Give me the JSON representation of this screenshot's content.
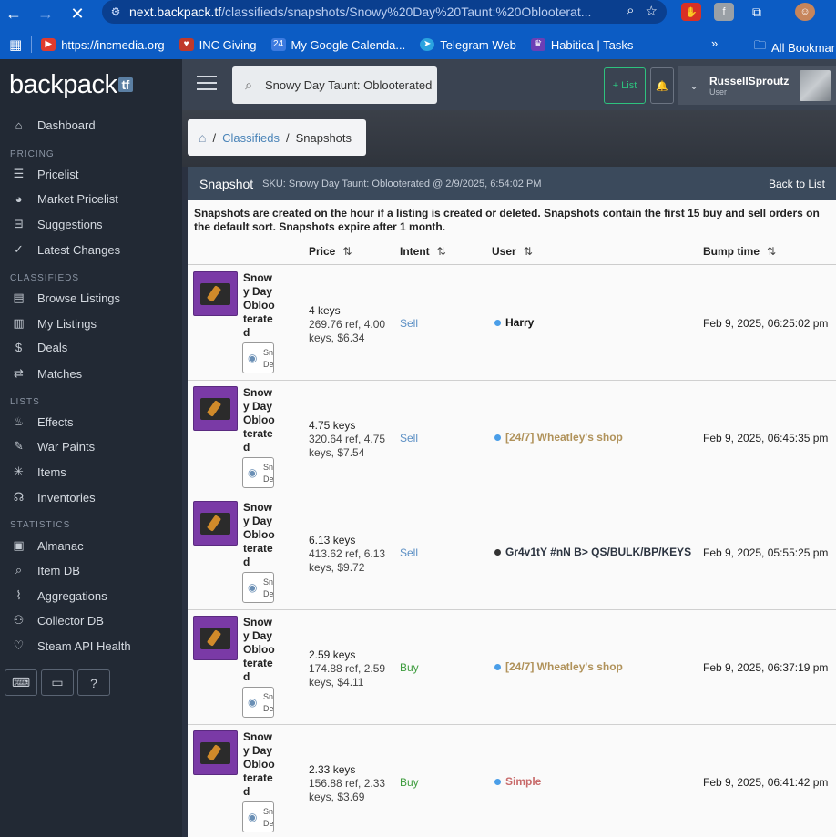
{
  "browser": {
    "url_host": "next.backpack.tf",
    "url_path": "/classifieds/snapshots/Snowy%20Day%20Taunt:%20Oblooterat...",
    "bookmarks": [
      {
        "label": "https://incmedia.org",
        "color": "#e03b2e"
      },
      {
        "label": "INC Giving",
        "color": "#c0392b"
      },
      {
        "label": "My Google Calenda...",
        "color": "#3d7be0"
      },
      {
        "label": "Telegram Web",
        "color": "#2aa3df"
      },
      {
        "label": "Habitica | Tasks",
        "color": "#6c3fb5"
      }
    ],
    "all_bookmarks": "All Bookmark"
  },
  "sidebar": {
    "logo": "backpack",
    "logo_tag": "tf",
    "items": [
      {
        "label": "Dashboard",
        "icon": "home-icon"
      },
      {
        "label": "Pricelist",
        "icon": "list-icon"
      },
      {
        "label": "Market Pricelist",
        "icon": "steam-icon"
      },
      {
        "label": "Suggestions",
        "icon": "inbox-icon"
      },
      {
        "label": "Latest Changes",
        "icon": "check-icon"
      },
      {
        "label": "Browse Listings",
        "icon": "newspaper-icon"
      },
      {
        "label": "My Listings",
        "icon": "listing-icon"
      },
      {
        "label": "Deals",
        "icon": "dollar-icon"
      },
      {
        "label": "Matches",
        "icon": "swap-icon"
      },
      {
        "label": "Effects",
        "icon": "flame-icon"
      },
      {
        "label": "War Paints",
        "icon": "brush-icon"
      },
      {
        "label": "Items",
        "icon": "asterisk-icon"
      },
      {
        "label": "Inventories",
        "icon": "backpack-icon"
      },
      {
        "label": "Almanac",
        "icon": "book-icon"
      },
      {
        "label": "Item DB",
        "icon": "search-icon"
      },
      {
        "label": "Aggregations",
        "icon": "chart-icon"
      },
      {
        "label": "Collector DB",
        "icon": "users-icon"
      },
      {
        "label": "Steam API Health",
        "icon": "heart-icon"
      }
    ],
    "sections": {
      "pricing": "PRICING",
      "classifieds": "CLASSIFIEDS",
      "lists": "LISTS",
      "statistics": "STATISTICS"
    }
  },
  "topbar": {
    "search_value": "Snowy Day Taunt: Oblooterated",
    "list_button": "+ List",
    "username": "RussellSproutz",
    "role": "User"
  },
  "breadcrumb": {
    "classifieds": "Classifieds",
    "current": "Snapshots"
  },
  "panel": {
    "title": "Snapshot",
    "sku": "SKU: Snowy Day Taunt: Oblooterated @ 2/9/2025, 6:54:02 PM",
    "back": "Back to List",
    "notice": "Snapshots are created on the hour if a listing is created or deleted. Snapshots contain the first 15 buy and sell orders on the default sort. Snapshots expire after 1 month.",
    "columns": {
      "price": "Price",
      "intent": "Intent",
      "user": "User",
      "bump": "Bump time"
    }
  },
  "rows": [
    {
      "item": "Snowy Day Oblooterated",
      "mini": "Sn De",
      "price_main": "4 keys",
      "price_sub": "269.76 ref, 4.00 keys, $6.34",
      "intent": "Sell",
      "user": "Harry",
      "user_color": "#111111",
      "dot_color": "#4a9ee8",
      "bump": "Feb 9, 2025, 06:25:02 pm"
    },
    {
      "item": "Snowy Day Oblooterated",
      "mini": "Sn De",
      "price_main": "4.75 keys",
      "price_sub": "320.64 ref, 4.75 keys, $7.54",
      "intent": "Sell",
      "user": "[24/7] Wheatley's shop",
      "user_color": "#b0925a",
      "dot_color": "#4a9ee8",
      "bump": "Feb 9, 2025, 06:45:35 pm"
    },
    {
      "item": "Snowy Day Oblooterated",
      "mini": "Sn De",
      "price_main": "6.13 keys",
      "price_sub": "413.62 ref, 6.13 keys, $9.72",
      "intent": "Sell",
      "user": "Gr4v1tY #nN B> QS/BULK/BP/KEYS",
      "user_color": "#2c3440",
      "dot_color": "#333333",
      "bump": "Feb 9, 2025, 05:55:25 pm"
    },
    {
      "item": "Snowy Day Oblooterated",
      "mini": "Sn De",
      "price_main": "2.59 keys",
      "price_sub": "174.88 ref, 2.59 keys, $4.11",
      "intent": "Buy",
      "user": "[24/7] Wheatley's shop",
      "user_color": "#b0925a",
      "dot_color": "#4a9ee8",
      "bump": "Feb 9, 2025, 06:37:19 pm"
    },
    {
      "item": "Snowy Day Oblooterated",
      "mini": "Sn De",
      "price_main": "2.33 keys",
      "price_sub": "156.88 ref, 2.33 keys, $3.69",
      "intent": "Buy",
      "user": "Simple",
      "user_color": "#c86a6a",
      "dot_color": "#4a9ee8",
      "bump": "Feb 9, 2025, 06:41:42 pm"
    }
  ]
}
